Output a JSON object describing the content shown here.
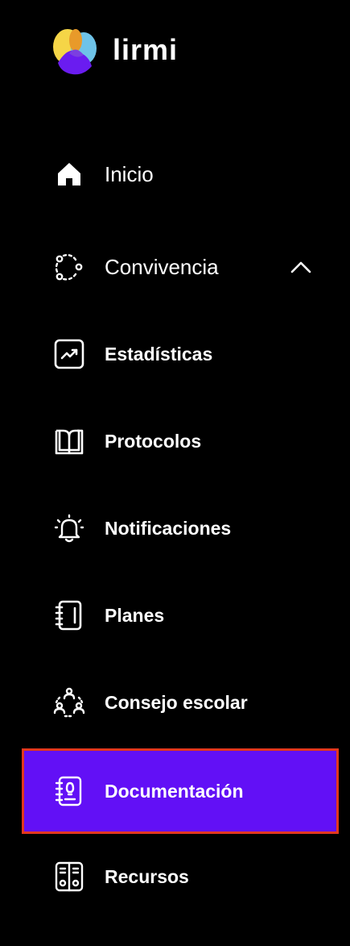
{
  "brand": {
    "name": "lirmi",
    "logo_icon": "lirmi-logo"
  },
  "colors": {
    "background": "#000000",
    "active": "#6210f6",
    "highlight_border": "#e2371f",
    "text": "#ffffff"
  },
  "nav": {
    "inicio": {
      "label": "Inicio",
      "icon": "home-icon"
    },
    "convivencia": {
      "label": "Convivencia",
      "icon": "network-circle-icon",
      "expanded": true
    },
    "estadisticas": {
      "label": "Estadísticas",
      "icon": "chart-trend-icon"
    },
    "protocolos": {
      "label": "Protocolos",
      "icon": "book-icon"
    },
    "notificaciones": {
      "label": "Notificaciones",
      "icon": "bell-icon"
    },
    "planes": {
      "label": "Planes",
      "icon": "notebook-icon"
    },
    "consejo": {
      "label": "Consejo escolar",
      "icon": "people-circle-icon"
    },
    "documentacion": {
      "label": "Documentación",
      "icon": "idea-notebook-icon",
      "active": true
    },
    "recursos": {
      "label": "Recursos",
      "icon": "binders-icon"
    }
  }
}
